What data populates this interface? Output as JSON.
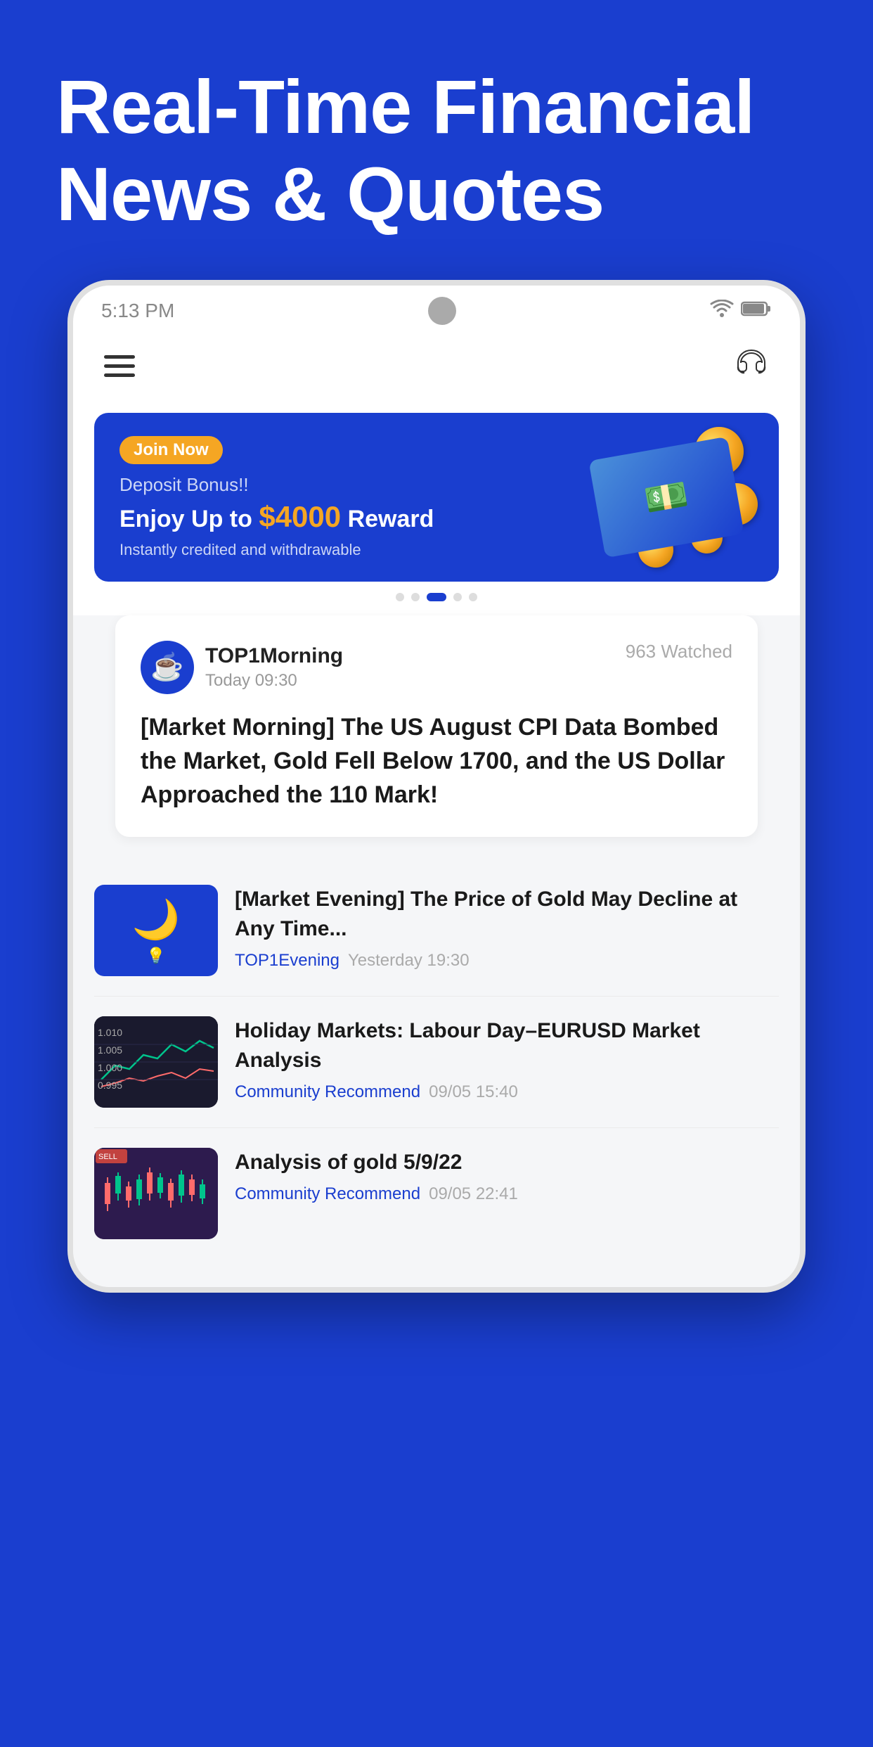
{
  "hero": {
    "title": "Real-Time Financial News & Quotes"
  },
  "statusBar": {
    "time": "5:13 PM"
  },
  "banner": {
    "joinNowLabel": "Join Now",
    "subtitle": "Deposit Bonus!!",
    "title": "Enjoy Up to ",
    "amount": "$4000",
    "amountSuffix": " Reward",
    "footer": "Instantly credited and withdrawable"
  },
  "bannerDots": [
    "dot",
    "dot",
    "active",
    "dot",
    "dot"
  ],
  "featuredCard": {
    "authorName": "TOP1Morning",
    "authorTime": "Today 09:30",
    "watchCount": "963 Watched",
    "title": "[Market Morning] The US  August CPI Data Bombed the Market, Gold Fell Below 1700, and the US Dollar Approached the 110 Mark!"
  },
  "newsList": [
    {
      "thumbType": "evening",
      "title": "[Market Evening] The Price of Gold May Decline at Any Time...",
      "source": "TOP1Evening",
      "time": "Yesterday 19:30"
    },
    {
      "thumbType": "chart1",
      "title": "Holiday Markets: Labour Day–EURUSD Market Analysis",
      "source": "Community Recommend",
      "time": "09/05 15:40"
    },
    {
      "thumbType": "chart2",
      "title": "Analysis of gold 5/9/22",
      "source": "Community Recommend",
      "time": "09/05 22:41"
    }
  ]
}
